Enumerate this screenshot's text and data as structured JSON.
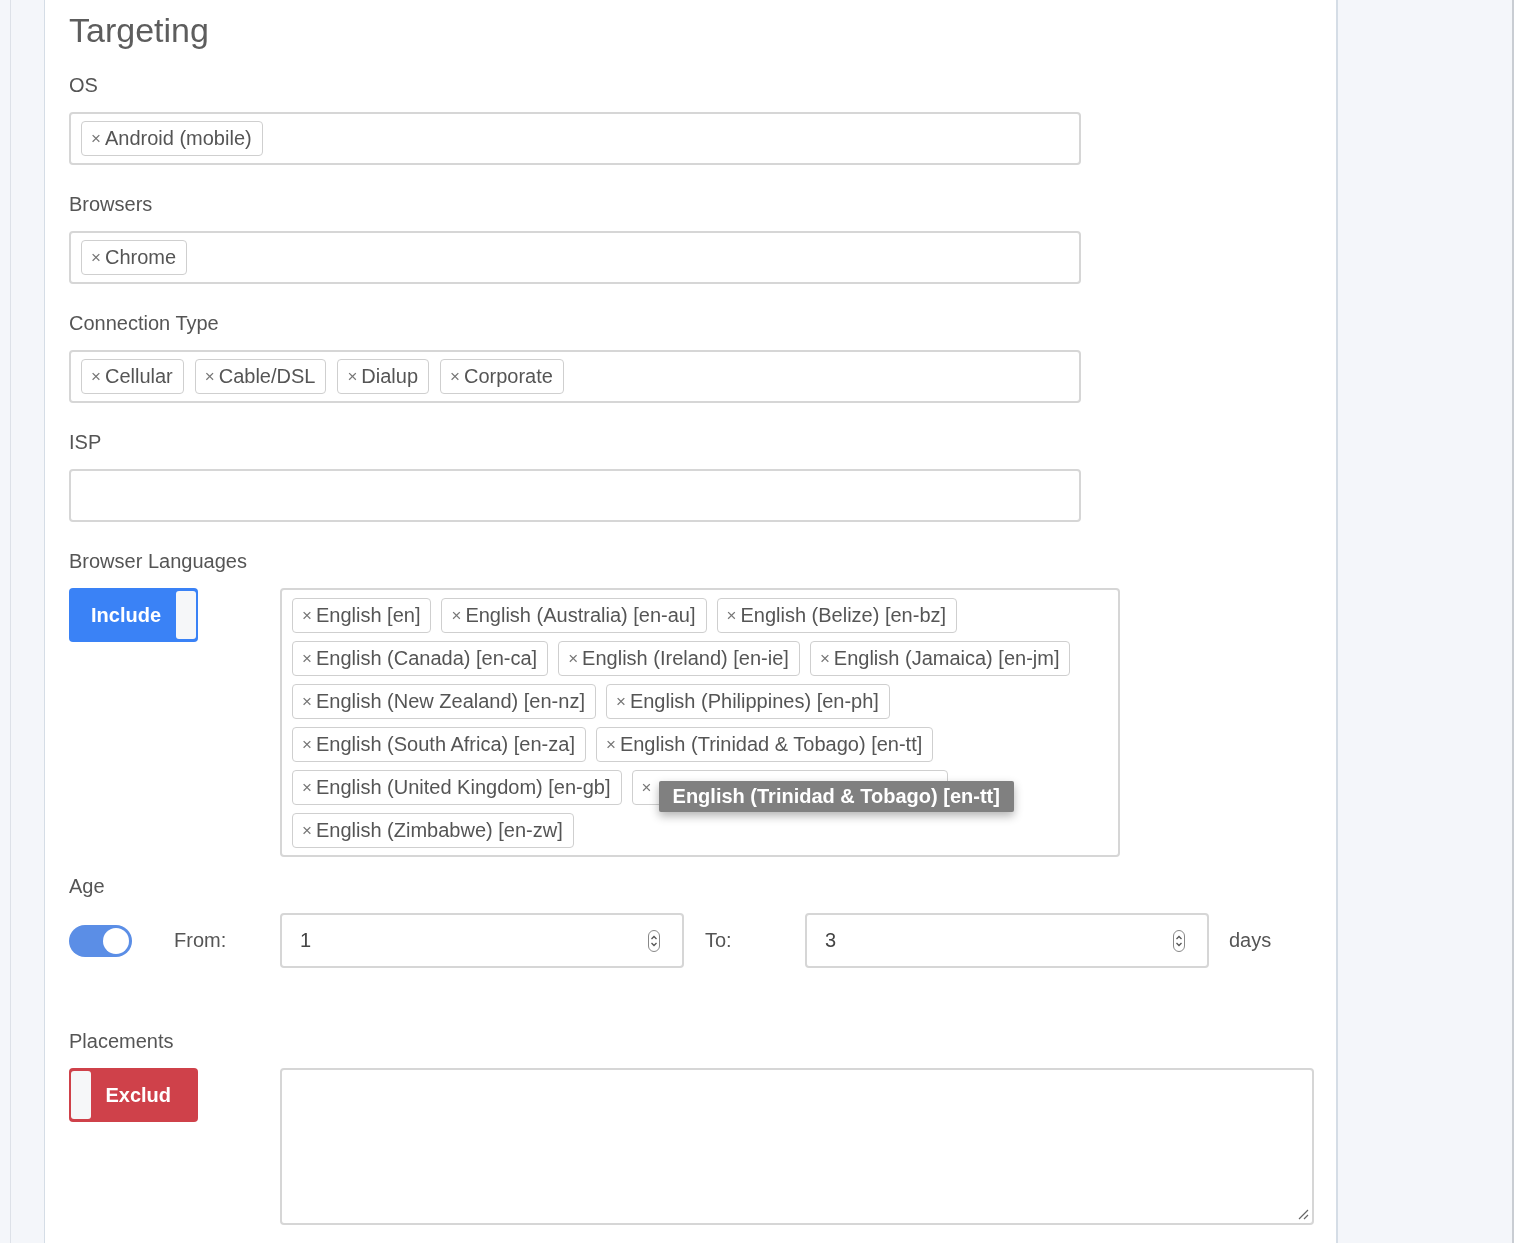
{
  "section": {
    "title": "Targeting"
  },
  "fields": [
    {
      "label": "OS",
      "tags": [
        {
          "remove": "×",
          "label": "Android (mobile)"
        }
      ]
    },
    {
      "label": "Browsers",
      "tags": [
        {
          "remove": "×",
          "label": "Chrome"
        }
      ]
    },
    {
      "label": "Connection Type",
      "tags": [
        {
          "remove": "×",
          "label": "Cellular"
        },
        {
          "remove": "×",
          "label": "Cable/DSL"
        },
        {
          "remove": "×",
          "label": "Dialup"
        },
        {
          "remove": "×",
          "label": "Corporate"
        }
      ]
    },
    {
      "label": "ISP"
    }
  ],
  "browser_languages": {
    "label": "Browser Languages",
    "mode": {
      "kind": "include",
      "label": "Include"
    },
    "tags": [
      {
        "remove": "×",
        "label": "English [en]"
      },
      {
        "remove": "×",
        "label": "English (Australia) [en-au]"
      },
      {
        "remove": "×",
        "label": "English (Belize) [en-bz]"
      },
      {
        "remove": "×",
        "label": "English (Canada) [en-ca]"
      },
      {
        "remove": "×",
        "label": "English (Ireland) [en-ie]"
      },
      {
        "remove": "×",
        "label": "English (Jamaica) [en-jm]"
      },
      {
        "remove": "×",
        "label": "English (New Zealand) [en-nz]"
      },
      {
        "remove": "×",
        "label": "English (Philippines) [en-ph]"
      },
      {
        "remove": "×",
        "label": "English (South Africa) [en-za]"
      },
      {
        "remove": "×",
        "label": "English (Trinidad & Tobago) [en-tt]"
      },
      {
        "remove": "×",
        "label": "English (United Kingdom) [en-gb]"
      },
      {
        "remove": "×",
        "tooltip": "English (Trinidad & Tobago) [en-tt]"
      },
      {
        "remove": "×",
        "label": "English (Zimbabwe) [en-zw]"
      }
    ]
  },
  "age": {
    "label": "Age",
    "on": true,
    "from_label": "From:",
    "from": "1",
    "to_label": "To:",
    "to": "3",
    "unit": "days"
  },
  "placements": {
    "label": "Placements",
    "mode": {
      "kind": "exclude",
      "label": "Exclud"
    }
  }
}
